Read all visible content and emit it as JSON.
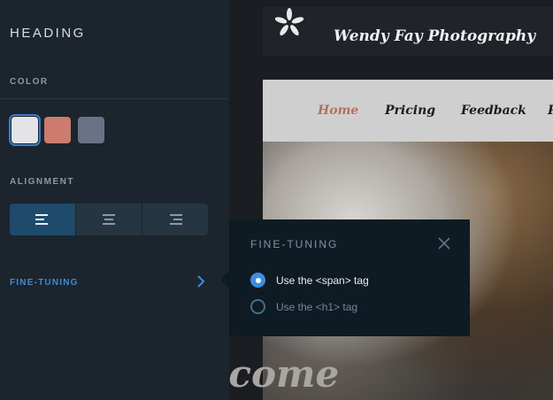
{
  "site": {
    "title": "Wendy Fay Photography",
    "nav": [
      "Home",
      "Pricing",
      "Feedback",
      "P"
    ],
    "hero_text": "Welcome"
  },
  "panel": {
    "title": "HEADING",
    "color_label": "COLOR",
    "alignment_label": "ALIGNMENT",
    "fine_tuning_label": "FINE-TUNING",
    "swatches": [
      "#e3e4e6",
      "#cc7b6c",
      "#6a7287"
    ],
    "selected_swatch": 0,
    "alignment_options": [
      "align-left-icon",
      "align-center-icon",
      "align-right-icon"
    ],
    "selected_alignment": 0
  },
  "popover": {
    "title": "FINE-TUNING",
    "options": [
      {
        "label": "Use the <span> tag",
        "checked": true
      },
      {
        "label": "Use the <h1> tag",
        "checked": false
      }
    ]
  },
  "colors": {
    "accent": "#3d8de0",
    "panel_bg": "#1c252e",
    "popover_bg": "#0f1b22",
    "active_nav": "#b56f62"
  }
}
